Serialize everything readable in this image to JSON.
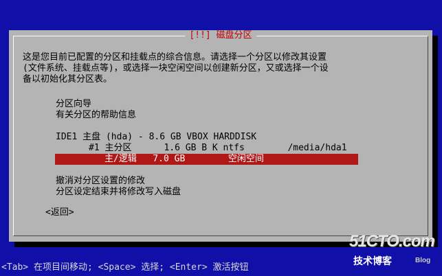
{
  "dialog": {
    "title": "[!!] 磁盘分区",
    "description": "这是您目前已配置的分区和挂载点的综合信息。请选择一个分区以修改其设置\n(文件系统、挂载点等)，或选择一块空闲空间以创建新分区，又或选择一个设\n备以初始化其分区表。",
    "items": {
      "guided_title": "分区向导",
      "guided_help": "有关分区的帮助信息",
      "disk": "IDE1 主盘 (hda) - 8.6 GB VBOX HARDDISK",
      "partition1": "#1 主分区      1.6 GB B K ntfs        /media/hda1",
      "free_space": "主/逻辑   7.0 GB        空闲空间",
      "undo": "撤消对分区设置的修改",
      "finish": "分区设定结束并将修改写入磁盘"
    },
    "back": "<返回>"
  },
  "hint": "<Tab> 在项目间移动; <Space> 选择; <Enter> 激活按钮",
  "watermark": {
    "site": "51CTO.com",
    "tagline": "技术博客",
    "blog": "Blog"
  },
  "colors": {
    "background": "#1010a8",
    "dialog": "#b4b4b4",
    "selection": "#b01818",
    "title": "#c00000"
  }
}
